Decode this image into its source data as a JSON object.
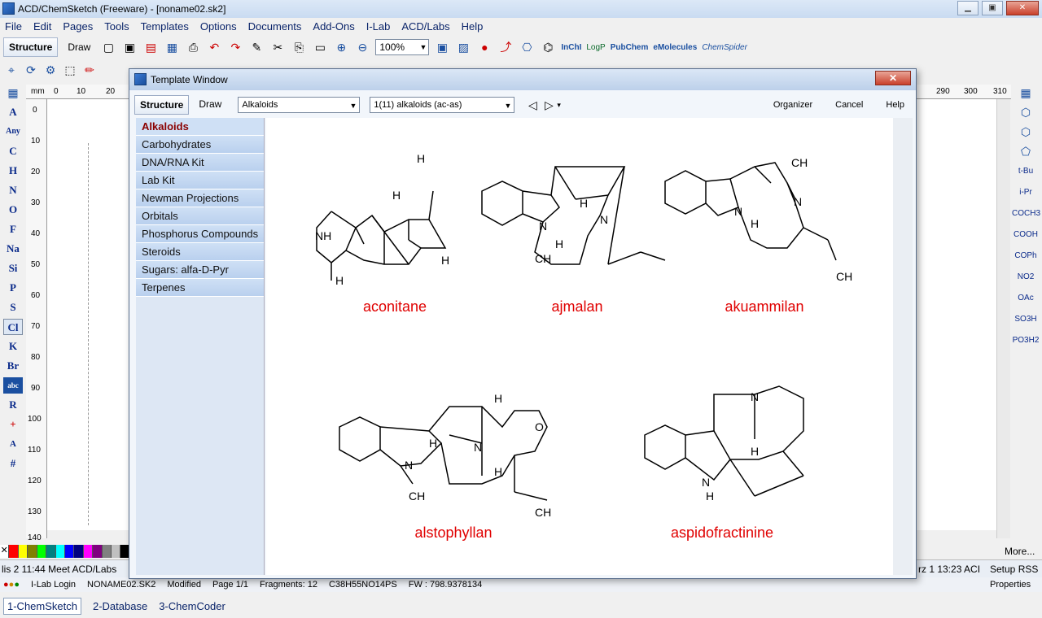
{
  "app": {
    "title": "ACD/ChemSketch (Freeware) - [noname02.sk2]"
  },
  "menu": [
    "File",
    "Edit",
    "Pages",
    "Tools",
    "Templates",
    "Options",
    "Documents",
    "Add-Ons",
    "I-Lab",
    "ACD/Labs",
    "Help"
  ],
  "toolbar": {
    "structure_label": "Structure",
    "draw_label": "Draw",
    "zoom": "100%",
    "inchi": "InChI",
    "logp": "LogP",
    "pubchem": "PubChem",
    "emolecules": "eMolecules",
    "chemspider": "ChemSpider"
  },
  "left_palette": [
    "A",
    "Any",
    "C",
    "H",
    "N",
    "O",
    "F",
    "Na",
    "Si",
    "P",
    "S",
    "Cl",
    "K",
    "Br",
    "abc",
    "R",
    "+",
    "A",
    "#"
  ],
  "right_palette": [
    "t-Bu",
    "i-Pr",
    "COCH3",
    "COOH",
    "COPh",
    "NO2",
    "OAc",
    "SO3H",
    "PO3H2"
  ],
  "ruler": {
    "unit": "mm",
    "top_ticks": [
      "0",
      "10",
      "20",
      "290",
      "300",
      "310"
    ],
    "left_ticks": [
      "0",
      "10",
      "20",
      "30",
      "40",
      "50",
      "60",
      "70",
      "80",
      "90",
      "100",
      "110",
      "120",
      "130",
      "140"
    ]
  },
  "dialog": {
    "title": "Template Window",
    "structure_tab": "Structure",
    "draw_tab": "Draw",
    "category_select": "Alkaloids",
    "page_select": "1(11) alkaloids (ac-as)",
    "organizer": "Organizer",
    "cancel": "Cancel",
    "help": "Help",
    "categories": [
      "Alkaloids",
      "Carbohydrates",
      "DNA/RNA Kit",
      "Lab Kit",
      "Newman Projections",
      "Orbitals",
      "Phosphorus Compounds",
      "Steroids",
      "Sugars: alfa-D-Pyr",
      "Terpenes"
    ],
    "molecules": [
      "aconitane",
      "ajmalan",
      "akuammilan",
      "alstophyllan",
      "aspidofractinine"
    ]
  },
  "status": {
    "news_left": "lis 2 11:44 Meet ACD/Labs",
    "news_right": "rz 1 13:23 ACI",
    "setup_rss": "Setup RSS",
    "more": "More...",
    "ilab_login": "I-Lab Login",
    "file": "NONAME02.SK2",
    "modified": "Modified",
    "page": "Page 1/1",
    "fragments": "Fragments: 12",
    "formula": "C38H55NO14PS",
    "fw": "FW : 798.9378134",
    "properties": "Properties"
  },
  "tabs": [
    "1-ChemSketch",
    "2-Database",
    "3-ChemCoder"
  ],
  "colors": {
    "accent": "#0a246a",
    "mol_label": "#e00000",
    "atom_number": "#0000cc",
    "palette": [
      "#ff0000",
      "#ffff00",
      "#808000",
      "#00ff00",
      "#008080",
      "#00ffff",
      "#0000ff",
      "#000080",
      "#ff00ff",
      "#800080",
      "#808080",
      "#c0c0c0",
      "#000000"
    ]
  }
}
